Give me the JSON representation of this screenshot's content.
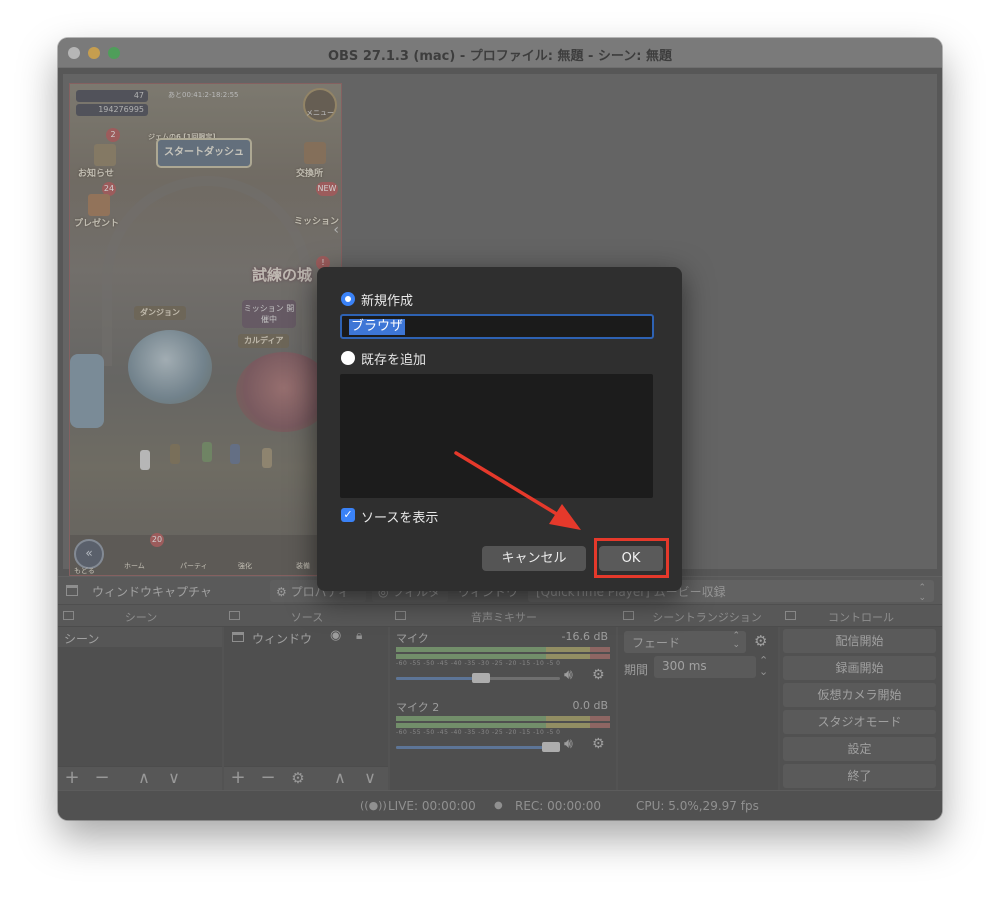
{
  "window": {
    "title": "OBS 27.1.3 (mac) - プロファイル: 無題 - シーン: 無題"
  },
  "game": {
    "stat1": "47",
    "stat2": "194276995",
    "timer": "あと00:41:2-18:2:55",
    "menu": "メニュー",
    "banner": "スタートダッシュ",
    "banner_small": "ジェムの6 [1回限定]",
    "left_labels": [
      "お知らせ",
      "プレゼント"
    ],
    "right_labels": [
      "交換所",
      "ミッション"
    ],
    "badges": [
      "2",
      "24",
      "NEW",
      "!"
    ],
    "castle_title": "試練の城",
    "castle_sub": "ミッション 開催中",
    "dungeon1": "ダンジョン",
    "dungeon2": "カルディア",
    "back": "もどる",
    "tabs": [
      "ホーム",
      "パーティ",
      "強化",
      "装備"
    ],
    "home_badge": "20"
  },
  "source_toolbar": {
    "source_name": "ウィンドウキャプチャ",
    "properties": "プロパティ",
    "filters": "フィルタ",
    "window_label": "ウィンドウ",
    "window_value": "[QuickTime Player] ムービー収録"
  },
  "docks": {
    "scenes": {
      "title": "シーン",
      "items": [
        "シーン"
      ]
    },
    "sources": {
      "title": "ソース",
      "items": [
        "ウィンドウ"
      ]
    },
    "mixer": {
      "title": "音声ミキサー",
      "ticks": "-60 -55 -50 -45 -40 -35 -30 -25 -20 -15 -10 -5 0",
      "channels": [
        {
          "name": "マイク",
          "db": "-16.6 dB",
          "volume": 0.52
        },
        {
          "name": "マイク 2",
          "db": "0.0 dB",
          "volume": 1.0
        }
      ]
    },
    "transitions": {
      "title": "シーントランジション",
      "type": "フェード",
      "duration_label": "期間",
      "duration": "300 ms"
    },
    "controls": {
      "title": "コントロール",
      "buttons": [
        "配信開始",
        "録画開始",
        "仮想カメラ開始",
        "スタジオモード",
        "設定",
        "終了"
      ]
    }
  },
  "status": {
    "live": "LIVE: 00:00:00",
    "rec": "REC: 00:00:00",
    "cpu": "CPU: 5.0%,29.97 fps"
  },
  "dialog": {
    "new_label": "新規作成",
    "name_value": "ブラウザ",
    "existing_label": "既存を追加",
    "visible_label": "ソースを表示",
    "cancel": "キャンセル",
    "ok": "OK"
  },
  "colors": {
    "accent": "#3a82f7",
    "highlight": "#e5392b"
  }
}
